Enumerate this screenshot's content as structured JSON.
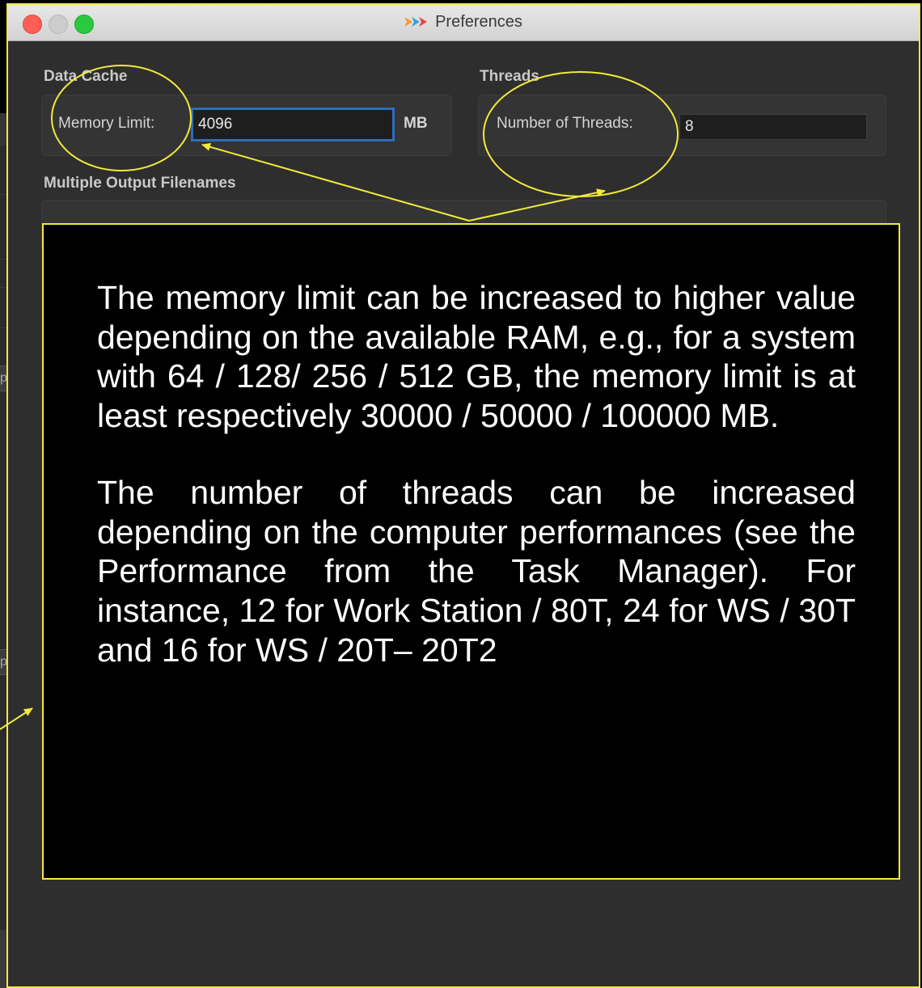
{
  "window": {
    "title": "Preferences",
    "traffic_lights": {
      "close": "#fd5f57",
      "minimize": "#cdcdcd",
      "maximize": "#2ac940"
    },
    "app_icon": "arrow-logo-icon"
  },
  "data_cache": {
    "section": "Data Cache",
    "memory_limit_label": "Memory Limit:",
    "memory_limit_value": "4096",
    "unit": "MB"
  },
  "threads": {
    "section": "Threads",
    "number_label": "Number of Threads:",
    "number_value": "8"
  },
  "output_filenames": {
    "section": "Multiple Output Filenames"
  },
  "annotation": {
    "paragraph_1": "The memory limit can be increased to higher value depending on the available RAM, e.g., for a system with 64 / 128/ 256 / 512 GB, the memory limit is at least respectively 30000 / 50000 / 100000 MB.",
    "paragraph_2": "The number of threads can be increased depending on the computer performances (see the Performance from the Task Manager). For instance, 12 for Work Station / 80T, 24 for WS / 30T and 16 for WS / 20T– 20T2",
    "highlight_color": "#f2ea3b"
  },
  "background_app": {
    "partial_label": "pu"
  }
}
